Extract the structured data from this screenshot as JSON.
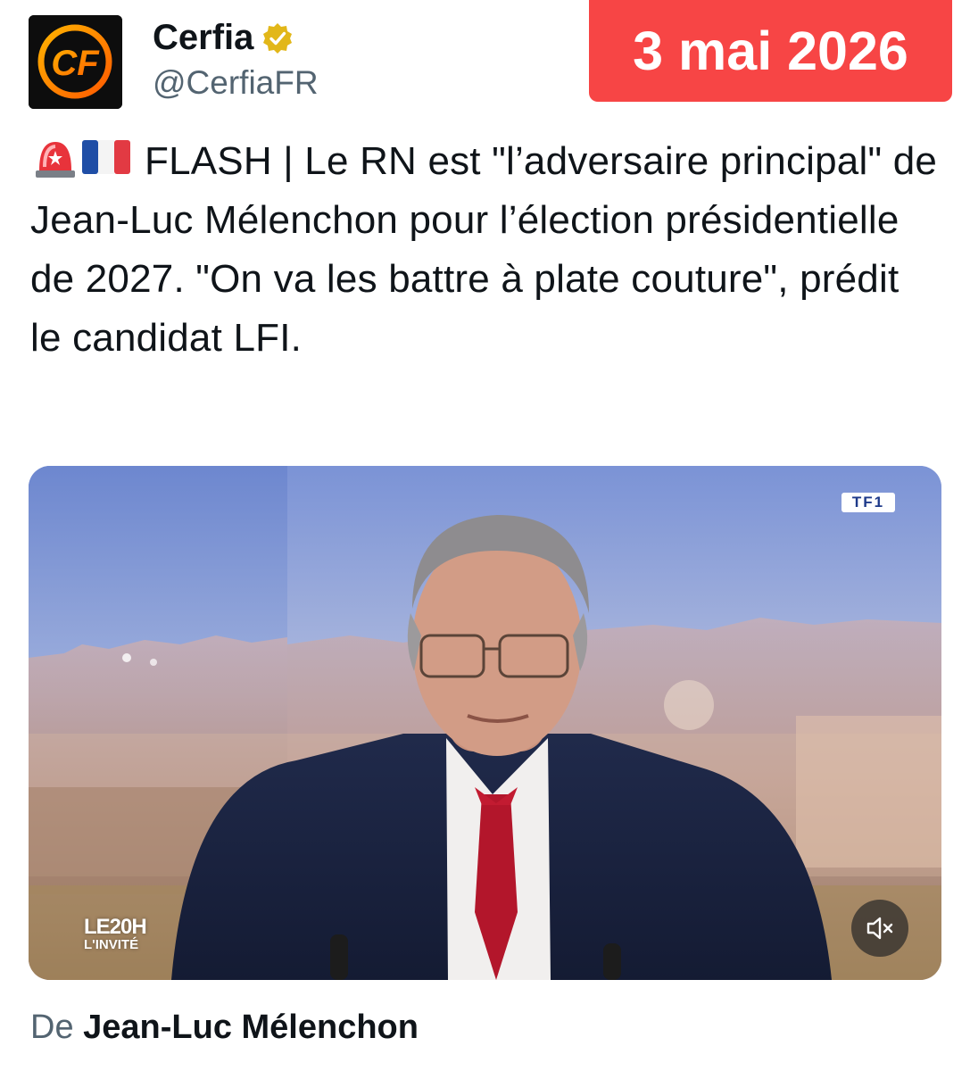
{
  "author": {
    "name": "Cerfia",
    "handle": "@CerfiaFR",
    "avatar_letters": "CF",
    "verified": true
  },
  "date_badge": "3 mai 2026",
  "post": {
    "text": "FLASH | Le RN est \"l’adversaire principal\" de Jean-Luc Mélenchon pour l’élection présidentielle de 2027. \"On va les battre à plate couture\", prédit le candidat LFI.",
    "leading_icons": [
      "siren-icon",
      "france-flag-icon"
    ]
  },
  "media": {
    "channel_logo": "TF1",
    "show_logo_line1": "LE20H",
    "show_logo_line2": "L'INVITÉ",
    "mute_icon": "speaker-muted-icon"
  },
  "attribution": {
    "prefix": "De",
    "name": "Jean-Luc Mélenchon"
  },
  "colors": {
    "badge": "#f74545",
    "handle": "#536471",
    "verified": "#e2b719",
    "text": "#0f1419"
  }
}
